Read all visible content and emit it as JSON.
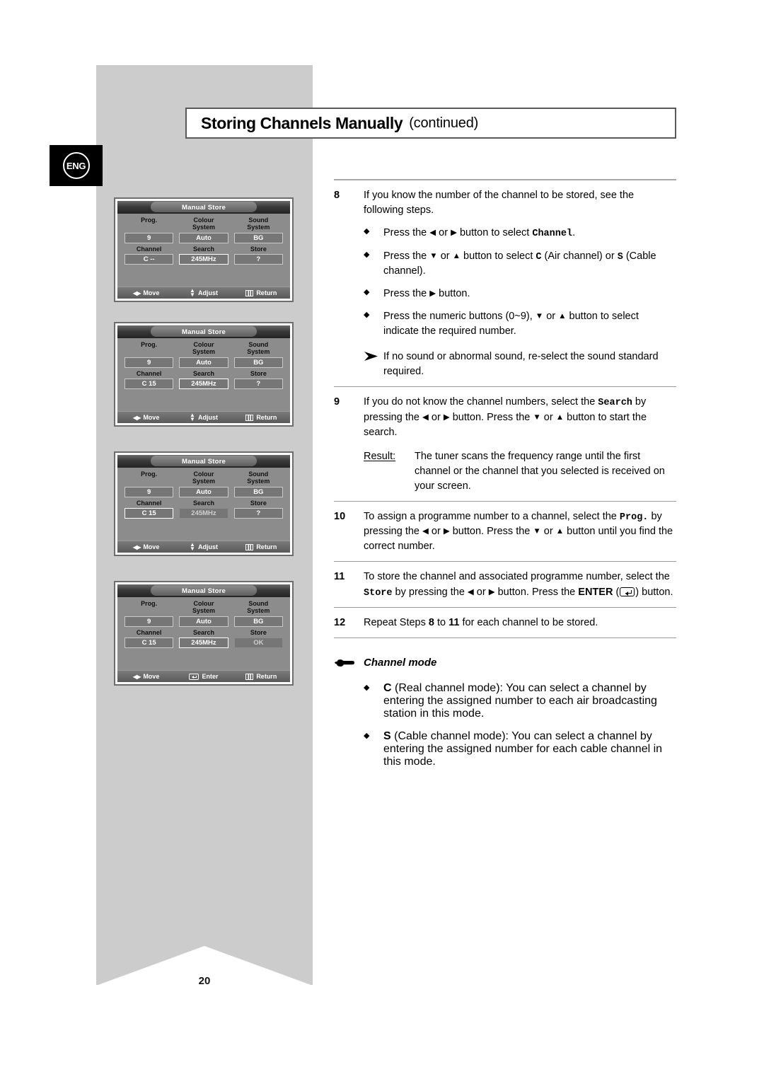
{
  "header": {
    "title_main": "Storing Channels Manually",
    "title_suffix": "(continued)",
    "lang_badge": "ENG",
    "page_number": "20"
  },
  "osd_screens": [
    {
      "title": "Manual Store",
      "labels_row1": [
        "Prog.",
        "Colour\nSystem",
        "Sound\nSystem"
      ],
      "values_row1": [
        "9",
        "Auto",
        "BG"
      ],
      "labels_row2": [
        "Channel",
        "Search",
        "Store"
      ],
      "values_row2": [
        "C  --",
        "245MHz",
        "?"
      ],
      "highlight": "search",
      "footer": [
        {
          "icon": "left-right-arrow-icon",
          "label": "Move"
        },
        {
          "icon": "up-down-arrow-icon",
          "label": "Adjust"
        },
        {
          "icon": "menu-icon",
          "label": "Return"
        }
      ]
    },
    {
      "title": "Manual Store",
      "labels_row1": [
        "Prog.",
        "Colour\nSystem",
        "Sound\nSystem"
      ],
      "values_row1": [
        "9",
        "Auto",
        "BG"
      ],
      "labels_row2": [
        "Channel",
        "Search",
        "Store"
      ],
      "values_row2": [
        "C  15",
        "245MHz",
        "?"
      ],
      "highlight": "search",
      "footer": [
        {
          "icon": "left-right-arrow-icon",
          "label": "Move"
        },
        {
          "icon": "up-down-arrow-icon",
          "label": "Adjust"
        },
        {
          "icon": "menu-icon",
          "label": "Return"
        }
      ]
    },
    {
      "title": "Manual Store",
      "labels_row1": [
        "Prog.",
        "Colour\nSystem",
        "Sound\nSystem"
      ],
      "values_row1": [
        "9",
        "Auto",
        "BG"
      ],
      "labels_row2": [
        "Channel",
        "Search",
        "Store"
      ],
      "values_row2": [
        "C  15",
        "245MHz",
        "?"
      ],
      "highlight": "channel",
      "footer": [
        {
          "icon": "left-right-arrow-icon",
          "label": "Move"
        },
        {
          "icon": "up-down-arrow-icon",
          "label": "Adjust"
        },
        {
          "icon": "menu-icon",
          "label": "Return"
        }
      ]
    },
    {
      "title": "Manual Store",
      "labels_row1": [
        "Prog.",
        "Colour\nSystem",
        "Sound\nSystem"
      ],
      "values_row1": [
        "9",
        "Auto",
        "BG"
      ],
      "labels_row2": [
        "Channel",
        "Search",
        "Store"
      ],
      "values_row2": [
        "C  15",
        "245MHz",
        "OK"
      ],
      "highlight": "search",
      "footer": [
        {
          "icon": "left-right-arrow-icon",
          "label": "Move"
        },
        {
          "icon": "enter-icon",
          "label": "Enter"
        },
        {
          "icon": "menu-icon",
          "label": "Return"
        }
      ]
    }
  ],
  "steps": {
    "s8": {
      "num": "8",
      "intro": "If you know the number of the channel to be stored, see the following steps.",
      "b1_a": "Press the ",
      "b1_left": "◀",
      "b1_or": " or ",
      "b1_right": "▶",
      "b1_b": " button to select ",
      "b1_code": "Channel",
      "b1_end": ".",
      "b2_a": "Press the ",
      "b2_down": "▼",
      "b2_or": " or ",
      "b2_up": "▲",
      "b2_b": " button to select ",
      "b2_c": "C",
      "b2_c_desc": " (Air channel) or ",
      "b2_s": "S",
      "b2_s_desc": " (Cable channel).",
      "b3_a": "Press the ",
      "b3_right": "▶",
      "b3_b": " button.",
      "b4_a": "Press the numeric buttons (0~9), ",
      "b4_down": "▼",
      "b4_or": " or ",
      "b4_up": "▲",
      "b4_b": " button to select indicate the required number.",
      "note": "If no sound or abnormal sound, re-select the sound standard required."
    },
    "s9": {
      "num": "9",
      "t_a": "If you do not know the channel numbers, select the ",
      "t_code": "Search",
      "t_b": " by pressing the ",
      "t_left": "◀",
      "t_or1": " or ",
      "t_right": "▶",
      "t_c": " button. Press the ",
      "t_down": "▼",
      "t_or2": " or ",
      "t_up": "▲",
      "t_d": " button to start the search.",
      "result_label": "Result:",
      "result_text": "The tuner scans the frequency range until the first channel or the channel that you selected is received on your screen."
    },
    "s10": {
      "num": "10",
      "t_a": "To assign a programme number to a channel, select the ",
      "t_code": "Prog.",
      "t_b": "  by pressing the ",
      "t_left": "◀",
      "t_or1": " or ",
      "t_right": "▶",
      "t_c": " button. Press the ",
      "t_down": "▼",
      "t_or2": " or ",
      "t_up": "▲",
      "t_d": " button until you find the correct number."
    },
    "s11": {
      "num": "11",
      "t_a": "To store the channel and associated programme number, select the ",
      "t_code": "Store",
      "t_b": " by pressing the ",
      "t_left": "◀",
      "t_or1": " or ",
      "t_right": "▶",
      "t_c": " button. Press the ",
      "t_enter": "ENTER",
      "t_open": " (",
      "t_close": ") button."
    },
    "s12": {
      "num": "12",
      "t_a": "Repeat Steps ",
      "t_from": "8",
      "t_mid": " to ",
      "t_to": "11",
      "t_b": " for each channel to be stored."
    }
  },
  "channel_mode": {
    "heading": "Channel mode",
    "hand_icon": "pointing-hand-icon",
    "items": [
      {
        "code": "C",
        "text": " (Real channel mode): You can select a channel by entering the assigned number to each air broadcasting station in this mode."
      },
      {
        "code": "S",
        "text": " (Cable channel mode): You can select a channel by entering the assigned number for each cable channel in this mode."
      }
    ]
  }
}
